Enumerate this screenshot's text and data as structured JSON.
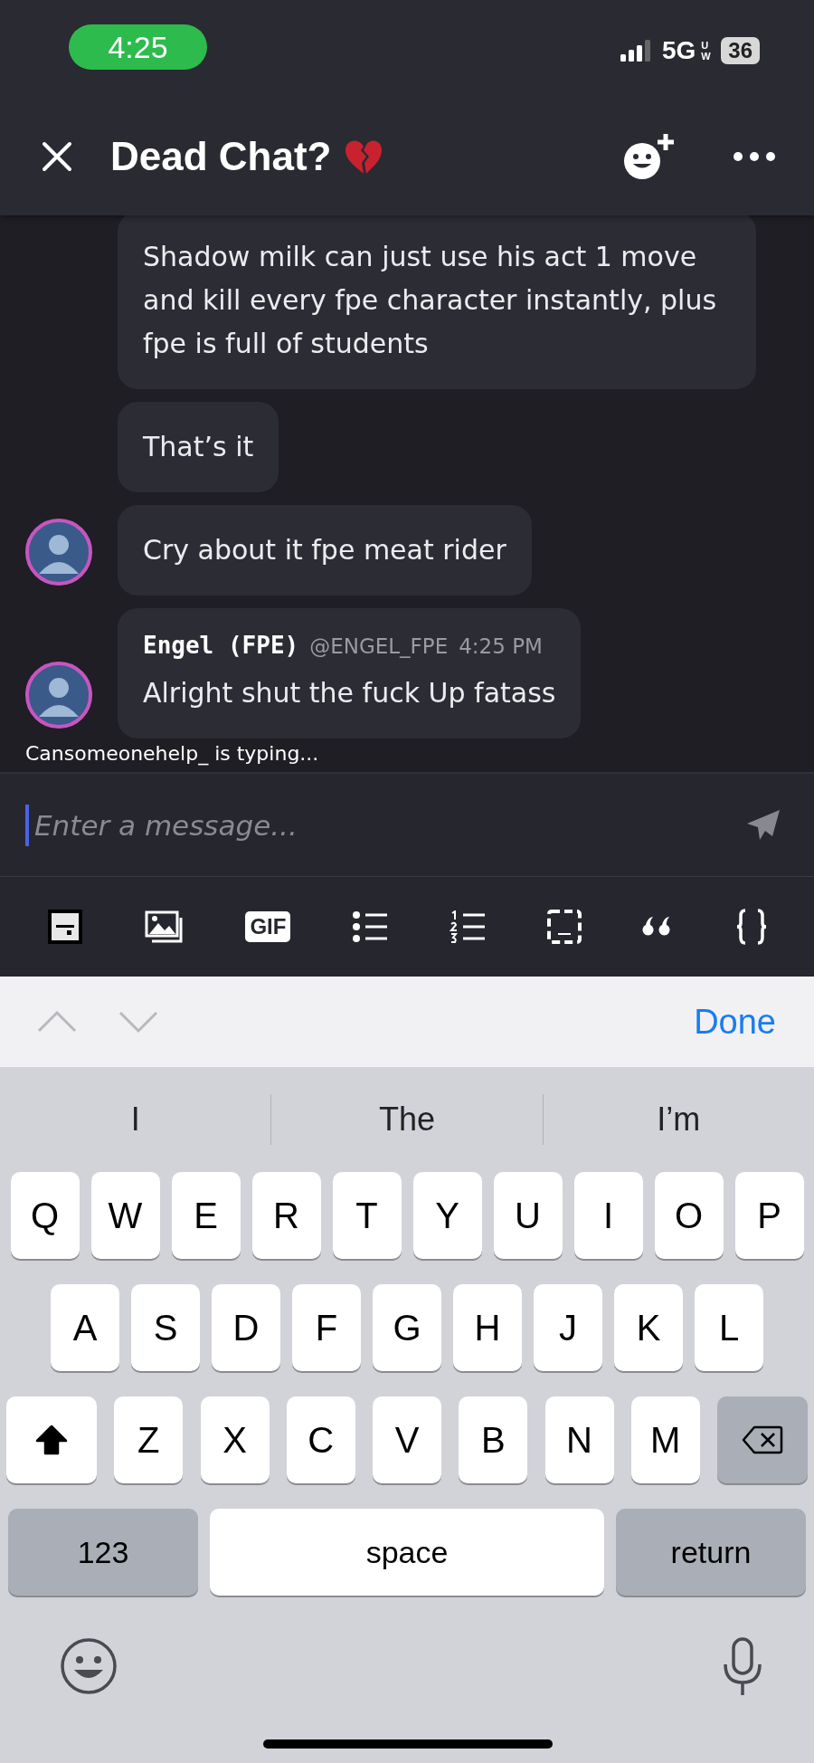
{
  "status_bar": {
    "time": "4:25",
    "network": "5G",
    "network_sub": "UW",
    "battery": "36"
  },
  "header": {
    "title": "Dead Chat?"
  },
  "messages": [
    {
      "avatar": false,
      "text": "Shadow milk can just use his act 1 move and kill every fpe character instantly, plus fpe is full of students"
    },
    {
      "avatar": false,
      "text": "That’s it"
    },
    {
      "avatar": true,
      "text": "Cry about it fpe meat rider"
    },
    {
      "avatar": true,
      "author": "Engel (FPE)",
      "handle": "@ENGEL_FPE",
      "time": "4:25 PM",
      "text": "Alright shut the fuck Up fatass"
    }
  ],
  "typing": "Cansomeonehelp_ is typing...",
  "composer": {
    "placeholder": "Enter a message..."
  },
  "toolbar": [
    {
      "kind": "sticker"
    },
    {
      "kind": "image"
    },
    {
      "kind": "gif",
      "label": "GIF"
    },
    {
      "kind": "bullets"
    },
    {
      "kind": "numbers"
    },
    {
      "kind": "spoiler"
    },
    {
      "kind": "quote"
    },
    {
      "kind": "code"
    }
  ],
  "accessory": {
    "done": "Done"
  },
  "suggestions": [
    "I",
    "The",
    "I’m"
  ],
  "keyboard": [
    [
      {
        "kind": "char",
        "label": "Q"
      },
      {
        "kind": "char",
        "label": "W"
      },
      {
        "kind": "char",
        "label": "E"
      },
      {
        "kind": "char",
        "label": "R"
      },
      {
        "kind": "char",
        "label": "T"
      },
      {
        "kind": "char",
        "label": "Y"
      },
      {
        "kind": "char",
        "label": "U"
      },
      {
        "kind": "char",
        "label": "I"
      },
      {
        "kind": "char",
        "label": "O"
      },
      {
        "kind": "char",
        "label": "P"
      }
    ],
    [
      {
        "kind": "char",
        "label": "A"
      },
      {
        "kind": "char",
        "label": "S"
      },
      {
        "kind": "char",
        "label": "D"
      },
      {
        "kind": "char",
        "label": "F"
      },
      {
        "kind": "char",
        "label": "G"
      },
      {
        "kind": "char",
        "label": "H"
      },
      {
        "kind": "char",
        "label": "J"
      },
      {
        "kind": "char",
        "label": "K"
      },
      {
        "kind": "char",
        "label": "L"
      }
    ],
    [
      {
        "kind": "shift",
        "on": true
      },
      {
        "kind": "char",
        "label": "Z"
      },
      {
        "kind": "char",
        "label": "X"
      },
      {
        "kind": "char",
        "label": "C"
      },
      {
        "kind": "char",
        "label": "V"
      },
      {
        "kind": "char",
        "label": "B"
      },
      {
        "kind": "char",
        "label": "N"
      },
      {
        "kind": "char",
        "label": "M"
      },
      {
        "kind": "backspace"
      }
    ],
    [
      {
        "kind": "mode",
        "label": "123"
      },
      {
        "kind": "space",
        "label": "space"
      },
      {
        "kind": "mode",
        "label": "return"
      }
    ]
  ]
}
